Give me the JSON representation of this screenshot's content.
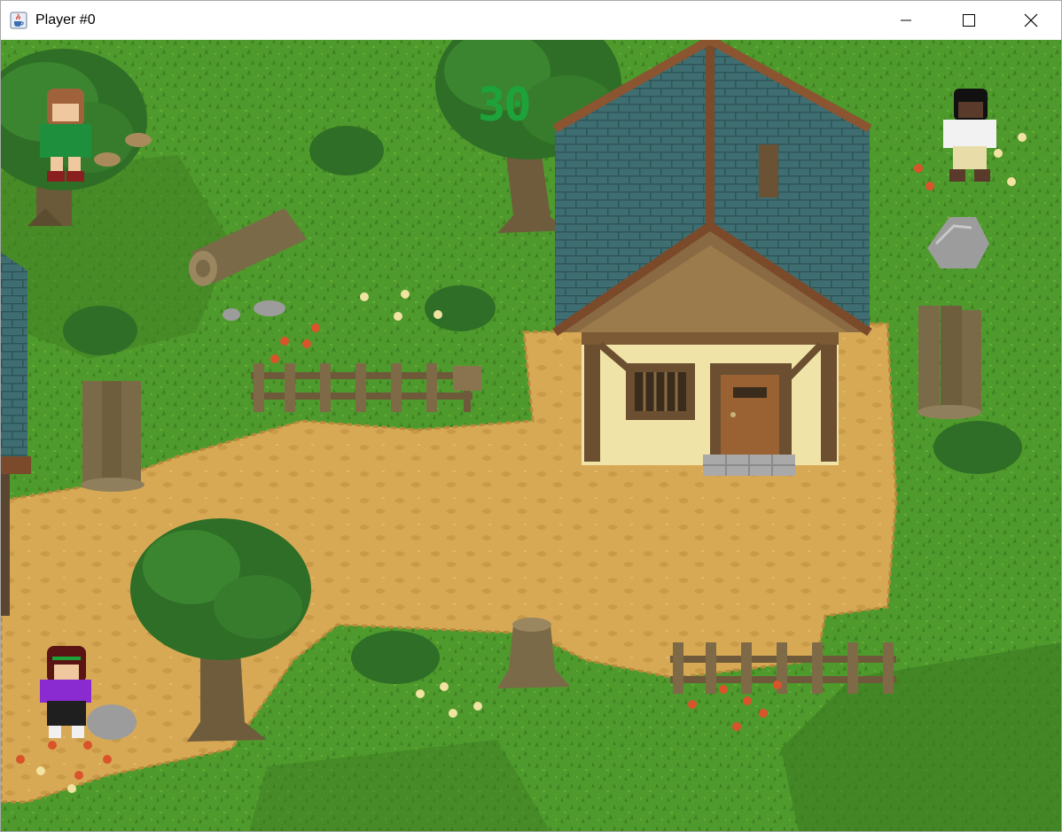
{
  "window": {
    "title": "Player #0",
    "app_icon": "java-cup-icon",
    "controls": [
      "minimize-icon",
      "maximize-icon",
      "close-icon"
    ]
  },
  "hud": {
    "timer": "30",
    "timer_color": "#1da33a"
  },
  "palette": {
    "grass": "#4f9a2c",
    "dirt": "#d7a955",
    "roof": "#3f6e72",
    "wall": "#f0e3a8"
  },
  "players": [
    {
      "id": "player-green-shirt",
      "shirt": "#1e8f3c",
      "hair": "#a0623a"
    },
    {
      "id": "player-white-shirt",
      "shirt": "#f2f2f2",
      "hair": "#111111"
    },
    {
      "id": "player-purple-shirt",
      "shirt": "#8a2bd2",
      "hair": "#5a1414"
    }
  ]
}
